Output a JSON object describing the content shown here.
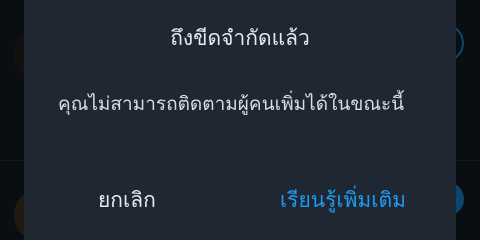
{
  "dialog": {
    "title": "ถึงขีดจำกัดแล้ว",
    "message": "คุณไม่สามารถติดตามผู้คนเพิ่มได้ในขณะนี้",
    "cancel_label": "ยกเลิก",
    "learn_more_label": "เรียนรู้เพิ่มเติม"
  },
  "colors": {
    "accent": "#1d9bf0",
    "dialog_bg": "#1e2732",
    "text_primary": "#e7e9ea"
  }
}
